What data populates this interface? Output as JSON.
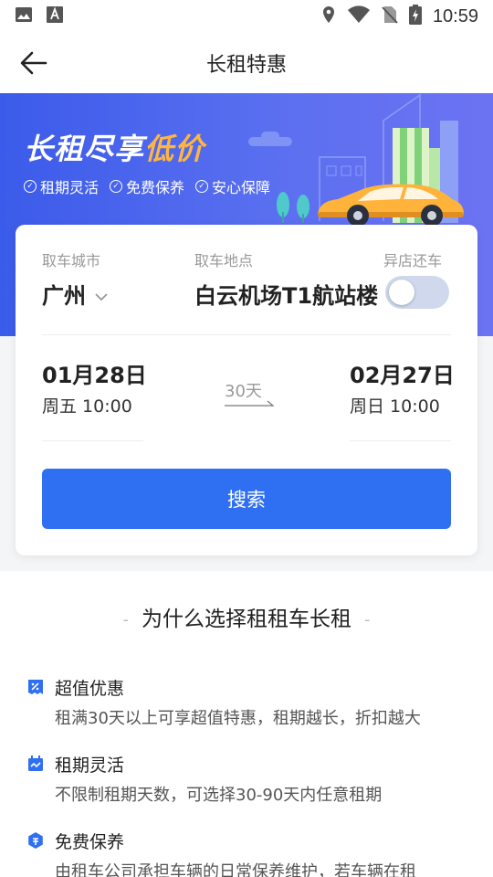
{
  "status_bar": {
    "time": "10:59",
    "icons": [
      "image-icon",
      "text-a-icon",
      "location-icon",
      "wifi-icon",
      "no-sim-icon",
      "battery-charging-icon"
    ]
  },
  "header": {
    "title": "长租特惠",
    "back_icon": "arrow-left-icon"
  },
  "banner": {
    "title_main": "长租尽享",
    "title_highlight": "低价",
    "features": [
      "租期灵活",
      "免费保养",
      "安心保障"
    ],
    "colors": {
      "bg": "#3b5bea",
      "highlight": "#ffb640",
      "car": "#ffb33a"
    }
  },
  "booking": {
    "city_label": "取车城市",
    "city_value": "广州",
    "location_label": "取车地点",
    "location_value": "白云机场T1航站楼",
    "return_label": "异店还车",
    "return_enabled": false,
    "pickup_date": "01月28日",
    "pickup_time": "周五 10:00",
    "duration": "30天",
    "return_date": "02月27日",
    "return_time": "周日 10:00",
    "search_label": "搜索",
    "colors": {
      "button": "#2f6ff2",
      "toggle_off": "#cfd8ec"
    }
  },
  "why": {
    "title": "为什么选择租租车长租",
    "items": [
      {
        "icon": "discount-icon",
        "title": "超值优惠",
        "desc": "租满30天以上可享超值特惠，租期越长，折扣越大"
      },
      {
        "icon": "calendar-icon",
        "title": "租期灵活",
        "desc": "不限制租期天数，可选择30-90天内任意租期"
      },
      {
        "icon": "maintenance-icon",
        "title": "免费保养",
        "desc": "由租车公司承担车辆的日常保养维护，若车辆在租"
      }
    ],
    "icon_color": "#2f6ff2"
  }
}
